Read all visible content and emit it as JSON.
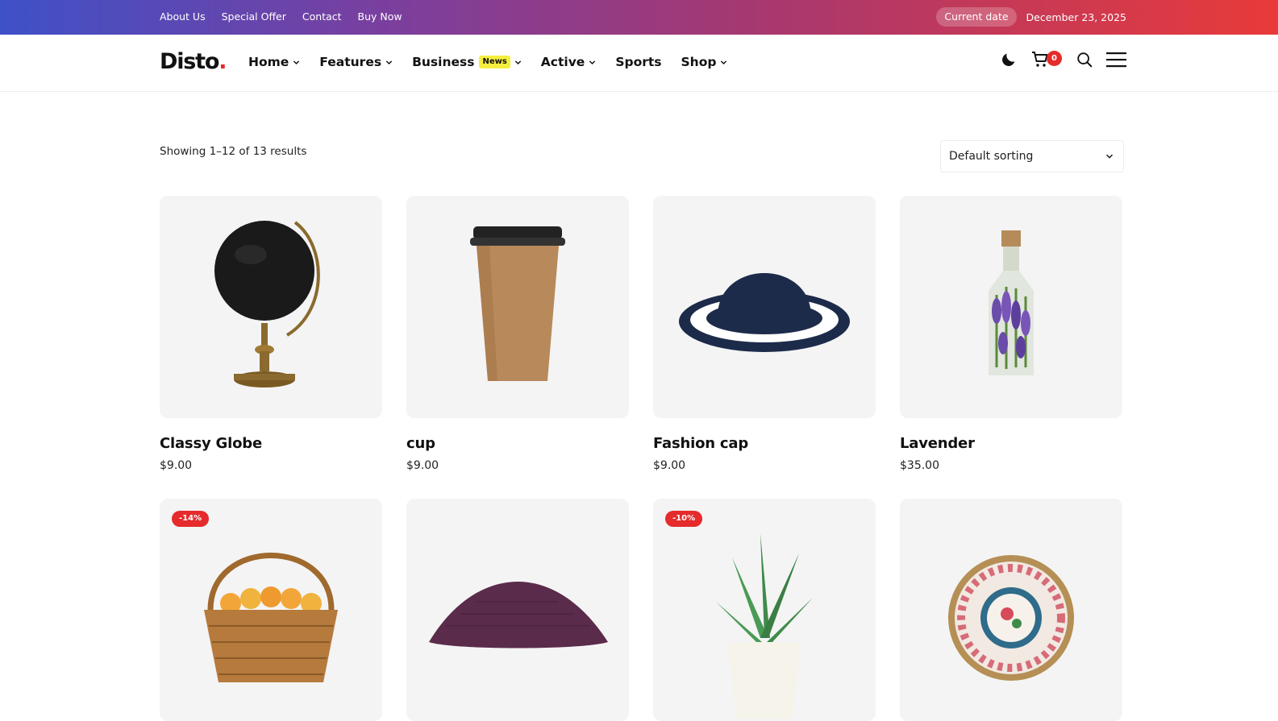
{
  "topbar": {
    "links": [
      "About Us",
      "Special Offer",
      "Contact",
      "Buy Now"
    ],
    "date_label": "Current date",
    "date_value": "December 23, 2025"
  },
  "header": {
    "logo": "Disto",
    "logo_dot": ".",
    "nav": [
      {
        "label": "Home",
        "has_dropdown": true
      },
      {
        "label": "Features",
        "has_dropdown": true
      },
      {
        "label": "Business",
        "badge": "News",
        "has_dropdown": true
      },
      {
        "label": "Active",
        "has_dropdown": true
      },
      {
        "label": "Sports",
        "has_dropdown": false
      },
      {
        "label": "Shop",
        "has_dropdown": true
      }
    ],
    "cart_count": "0"
  },
  "shop": {
    "result_count": "Showing 1–12 of 13 results",
    "sorting": "Default sorting",
    "products": [
      {
        "title": "Classy Globe",
        "price": "$9.00",
        "icon": "globe"
      },
      {
        "title": "cup",
        "price": "$9.00",
        "icon": "coffee-cup"
      },
      {
        "title": "Fashion cap",
        "price": "$9.00",
        "icon": "sun-hat"
      },
      {
        "title": "Lavender",
        "price": "$35.00",
        "icon": "lavender-bottle"
      },
      {
        "title": "",
        "price": "",
        "icon": "fruit-basket",
        "sale": "-14%"
      },
      {
        "title": "",
        "price": "",
        "icon": "pillow"
      },
      {
        "title": "",
        "price": "",
        "icon": "succulent-plant",
        "sale": "-10%"
      },
      {
        "title": "",
        "price": "",
        "icon": "decorative-plate"
      }
    ]
  },
  "colors": {
    "accent": "#e52b2b",
    "badge_yellow": "#f6ee3f",
    "topbar_start": "#3f51c8",
    "topbar_end": "#e83a3a"
  }
}
